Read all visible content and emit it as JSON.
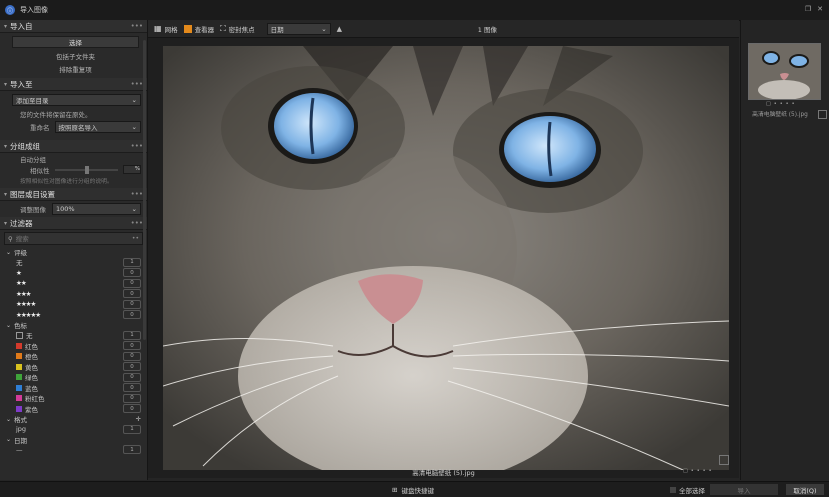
{
  "window": {
    "title": "导入图像"
  },
  "sidebar": {
    "import_from": {
      "title": "导入自",
      "select_button": "选择",
      "include_subfolders": "包括子文件夹",
      "exclude_duplicates": "排除重复项"
    },
    "import_to": {
      "title": "导入至",
      "destination": "添加至目录",
      "note": "您的文件将保留在原处。",
      "rename_label": "重命名",
      "rename_value": "按照原名导入"
    },
    "group": {
      "title": "分组成组",
      "auto_group": "自动分组",
      "similarity_label": "相似性",
      "similarity_unit": "%",
      "hint": "按照相似性对图像进行分组的说明。"
    },
    "metadata": {
      "title": "图层或目设置",
      "label": "调整图像",
      "value": "100%"
    },
    "filters": {
      "title": "过滤器",
      "search_placeholder": "搜索",
      "rating": {
        "title": "评级",
        "items": [
          {
            "label": "无",
            "stars": "",
            "count": "1"
          },
          {
            "label": "",
            "stars": "★",
            "count": "0"
          },
          {
            "label": "",
            "stars": "★★",
            "count": "0"
          },
          {
            "label": "",
            "stars": "★★★",
            "count": "0"
          },
          {
            "label": "",
            "stars": "★★★★",
            "count": "0"
          },
          {
            "label": "",
            "stars": "★★★★★",
            "count": "0"
          }
        ]
      },
      "color": {
        "title": "色标",
        "items": [
          {
            "label": "无",
            "color": "",
            "count": "1"
          },
          {
            "label": "红色",
            "color": "#d33a2c",
            "count": "0"
          },
          {
            "label": "橙色",
            "color": "#e07a1a",
            "count": "0"
          },
          {
            "label": "黄色",
            "color": "#d9c21f",
            "count": "0"
          },
          {
            "label": "绿色",
            "color": "#3fa43a",
            "count": "0"
          },
          {
            "label": "蓝色",
            "color": "#2f7fd6",
            "count": "0"
          },
          {
            "label": "粉红色",
            "color": "#d23b9a",
            "count": "0"
          },
          {
            "label": "紫色",
            "color": "#7f3bc9",
            "count": "0"
          }
        ]
      },
      "format": {
        "title": "格式",
        "items": [
          {
            "label": "jpg",
            "count": "1"
          }
        ]
      },
      "date": {
        "title": "日期",
        "items": [
          {
            "label": "—",
            "count": "1"
          }
        ]
      }
    }
  },
  "toolbar": {
    "grid": "网格",
    "viewer": "查看器",
    "compare": "密封焦点",
    "sort_value": "日期",
    "count": "1 图像"
  },
  "viewer": {
    "caption": "高清电脑壁纸 (5).jpg"
  },
  "right_panel": {
    "thumb_caption": "高清电脑壁纸 (5).jpg"
  },
  "bottombar": {
    "center_button": "键盘快捷键",
    "select_all": "全部选择",
    "secondary": "导入",
    "import_button": "取消(Q)"
  }
}
